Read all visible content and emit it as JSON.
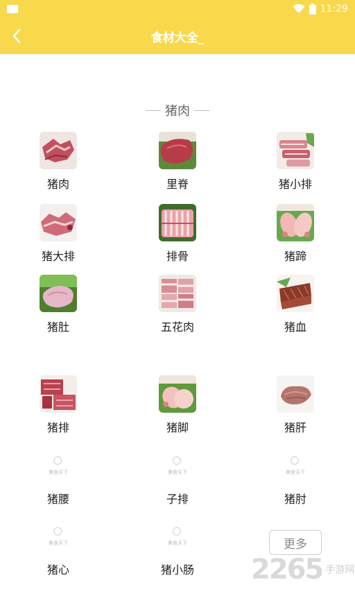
{
  "status_bar": {
    "time": "11:29",
    "icons": [
      "app-icon",
      "wifi-icon",
      "battery-icon"
    ]
  },
  "app_bar": {
    "title": "食材大全_",
    "back_icon": "chevron-left-icon",
    "color": "#f8d94e"
  },
  "section": {
    "title": "猪肉"
  },
  "items": [
    {
      "label": "猪肉",
      "image": "pork-icon"
    },
    {
      "label": "里脊",
      "image": "tenderloin-icon"
    },
    {
      "label": "猪小排",
      "image": "small-ribs-icon"
    },
    {
      "label": "猪大排",
      "image": "pork-chop-icon"
    },
    {
      "label": "排骨",
      "image": "spare-ribs-icon"
    },
    {
      "label": "猪蹄",
      "image": "trotters-icon"
    },
    {
      "label": "猪肚",
      "image": "pork-tripe-icon"
    },
    {
      "label": "五花肉",
      "image": "pork-belly-icon"
    },
    {
      "label": "猪血",
      "image": "pork-blood-icon"
    },
    {
      "label": "猪排",
      "image": "pork-cutlet-icon"
    },
    {
      "label": "猪脚",
      "image": "pig-feet-icon"
    },
    {
      "label": "猪肝",
      "image": "pork-liver-icon"
    },
    {
      "label": "猪腰",
      "image_placeholder": "美食天下"
    },
    {
      "label": "子排",
      "image_placeholder": "美食天下"
    },
    {
      "label": "猪肘",
      "image_placeholder": "美食天下"
    },
    {
      "label": "猪心",
      "image_placeholder": "美食天下"
    },
    {
      "label": "猪小肠",
      "image_placeholder": "美食天下"
    }
  ],
  "more_button": {
    "label": "更多"
  },
  "watermark": {
    "number": "2265",
    "site": "手游网"
  }
}
